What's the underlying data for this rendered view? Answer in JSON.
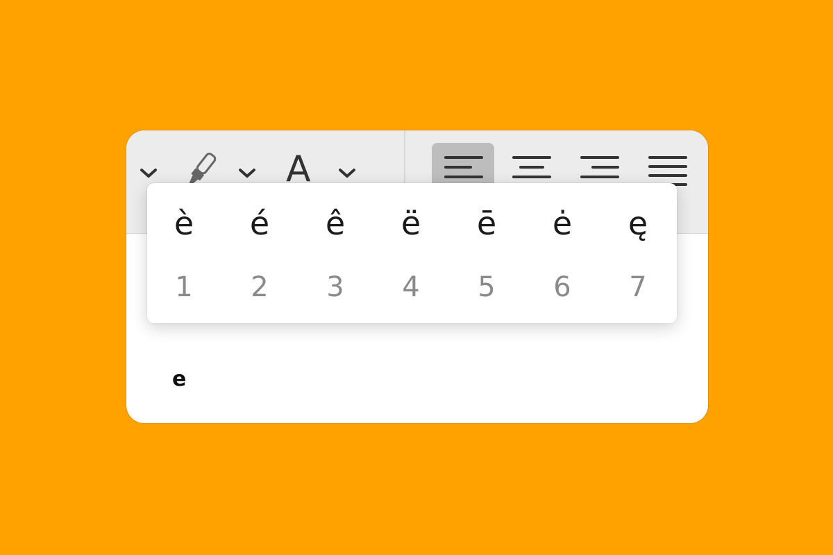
{
  "colors": {
    "background": "#FFA200",
    "window": "#FFFFFF",
    "toolbar": "#ECECEC",
    "active_align": "#BDBDBD",
    "accent_text": "#1A1A1A",
    "number_text": "#8A8A8A"
  },
  "toolbar": {
    "font_color_glyph": "A",
    "icons": [
      "chevron-down-icon",
      "highlighter-icon",
      "chevron-down-icon",
      "font-color-icon",
      "chevron-down-icon",
      "align-left-icon",
      "align-center-icon",
      "align-right-icon",
      "align-justify-icon"
    ],
    "active_alignment": "align-left"
  },
  "editor": {
    "typed_char": "e"
  },
  "accent_popover": {
    "options": [
      {
        "char": "è",
        "number": "1"
      },
      {
        "char": "é",
        "number": "2"
      },
      {
        "char": "ê",
        "number": "3"
      },
      {
        "char": "ë",
        "number": "4"
      },
      {
        "char": "ē",
        "number": "5"
      },
      {
        "char": "ė",
        "number": "6"
      },
      {
        "char": "ę",
        "number": "7"
      }
    ]
  }
}
